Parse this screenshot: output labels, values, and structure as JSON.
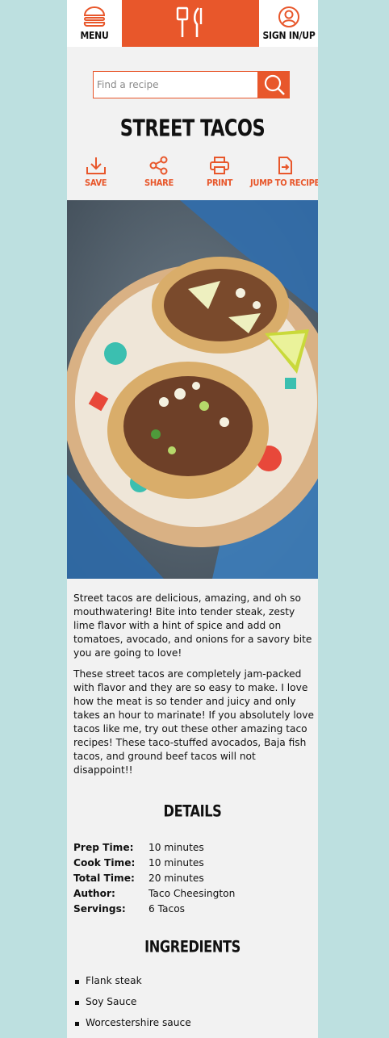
{
  "header": {
    "menu_label": "MENU",
    "signin_label": "SIGN IN/UP",
    "brand_color": "#e8572b",
    "logo_icon": "spatula-fork-icon"
  },
  "search": {
    "placeholder": "Find a recipe",
    "value": ""
  },
  "recipe": {
    "title": "STREET TACOS",
    "actions": [
      {
        "label": "SAVE",
        "icon": "download-icon"
      },
      {
        "label": "SHARE",
        "icon": "share-icon"
      },
      {
        "label": "PRINT",
        "icon": "printer-icon"
      },
      {
        "label": "JUMP TO RECIPE",
        "icon": "jump-arrow-icon"
      }
    ],
    "paragraphs": [
      "Street tacos are delicious, amazing, and oh so mouthwatering! Bite into tender steak, zesty lime flavor with a hint of spice and add on tomatoes, avocado, and onions for a savory bite you are going to love!",
      "These street tacos are completely jam-packed with flavor and they are so easy to make. I love how the meat is so tender and juicy and only takes an hour to marinate! If you absolutely love tacos like me, try out these other amazing taco recipes! These taco-stuffed avocados, Baja fish tacos, and ground beef tacos will not disappoint!!"
    ]
  },
  "details": {
    "heading": "DETAILS",
    "rows": [
      {
        "key": "Prep Time:",
        "value": "10 minutes"
      },
      {
        "key": "Cook Time:",
        "value": "10 minutes"
      },
      {
        "key": "Total Time:",
        "value": "20 minutes"
      },
      {
        "key": "Author:",
        "value": "Taco Cheesington"
      },
      {
        "key": "Servings:",
        "value": "6 Tacos"
      }
    ]
  },
  "ingredients": {
    "heading": "INGREDIENTS",
    "items": [
      "Flank steak",
      "Soy Sauce",
      "Worcestershire sauce"
    ]
  }
}
